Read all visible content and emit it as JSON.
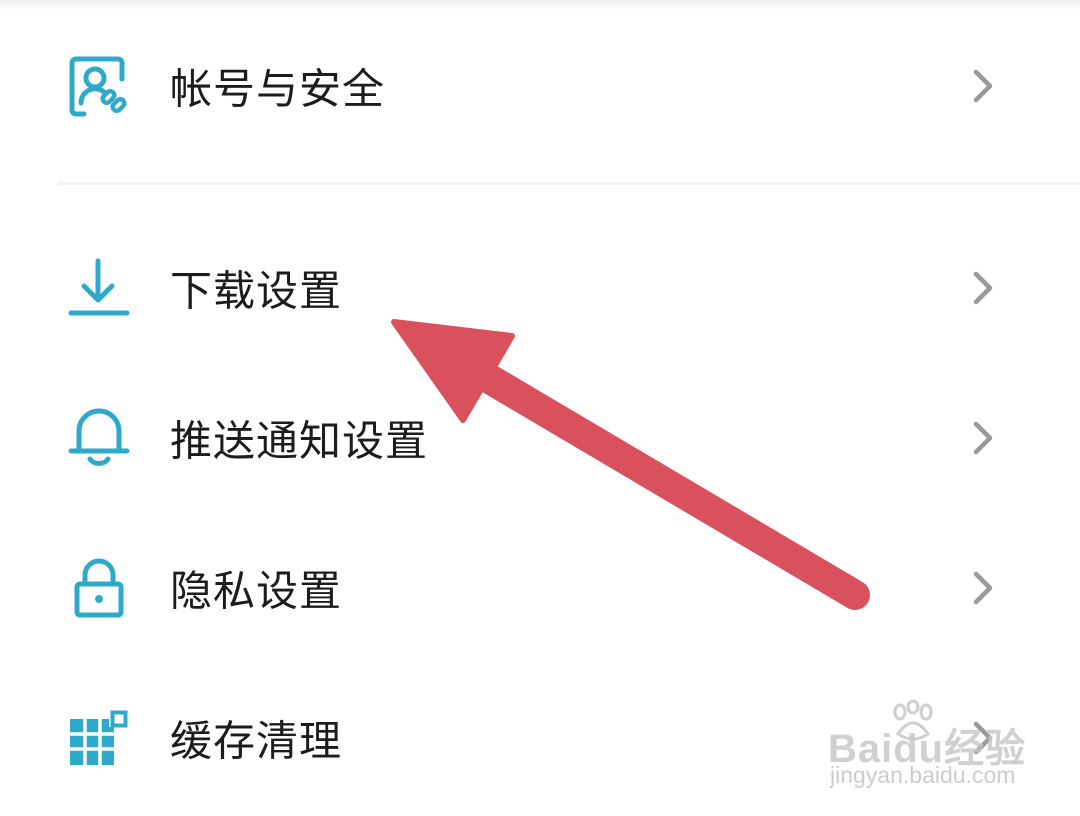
{
  "settings": {
    "items": [
      {
        "label": "帐号与安全",
        "icon": "account-security-icon"
      },
      {
        "label": "下载设置",
        "icon": "download-icon"
      },
      {
        "label": "推送通知设置",
        "icon": "bell-icon"
      },
      {
        "label": "隐私设置",
        "icon": "lock-icon"
      },
      {
        "label": "缓存清理",
        "icon": "cache-grid-icon"
      }
    ]
  },
  "colors": {
    "icon": "#2fa9c9",
    "text": "#1c1c1c",
    "chevron": "#9a9a9a",
    "annotation_arrow": "#d9515c"
  },
  "watermark": {
    "logo": "Baidu经验",
    "url": "jingyan.baidu.com"
  }
}
